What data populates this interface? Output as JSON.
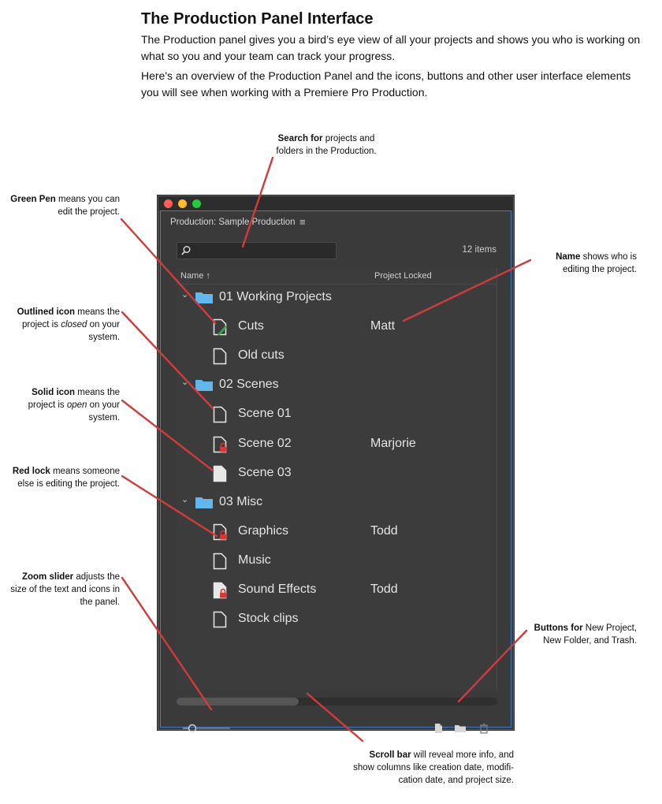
{
  "header": {
    "title": "The Production Panel Interface",
    "paragraph1": "The Production panel gives you a bird’s eye view of all your projects and shows you who is working on what so you and your team can track your progress.",
    "paragraph2": "Here's an overview of the Production Panel and the icons, buttons and other user interface elements you will see when working with a Premiere Pro Production."
  },
  "callouts": {
    "search": {
      "bold": "Search for",
      "rest1": " projects and",
      "line2": "folders in the Production."
    },
    "green_pen": {
      "bold": "Green Pen",
      "rest1": " means you can",
      "line2": "edit the project."
    },
    "outlined": {
      "bold": "Outlined icon",
      "rest1": " means the",
      "line2a": "project is ",
      "line2i": "closed",
      "line2b": " on your",
      "line3": "system."
    },
    "solid": {
      "bold": "Solid icon",
      "rest1": " means the",
      "line2a": "project is ",
      "line2i": "open",
      "line2b": " on your",
      "line3": "system."
    },
    "red_lock": {
      "bold": "Red lock",
      "rest1": " means someone",
      "line2": "else is editing the project."
    },
    "zoom": {
      "bold": "Zoom slider",
      "rest1": " adjusts the",
      "line2": "size of the text and icons in",
      "line3": "the panel."
    },
    "name": {
      "bold": "Name",
      "rest1": " shows who is",
      "line2": "editing the project."
    },
    "buttons": {
      "bold": "Buttons for",
      "rest1": " New Project,",
      "line2": "New Folder, and Trash."
    },
    "scroll": {
      "bold": "Scroll bar",
      "rest1": " will reveal more info, and",
      "line2": "show columns like creation date, modifi-",
      "line3": "cation date, and project size."
    }
  },
  "panel": {
    "title": "Production: Sample Production",
    "menu_glyph": "≡",
    "search_placeholder": "",
    "item_count": "12 items",
    "columns": {
      "name": "Name ↑",
      "locked": "Project Locked"
    },
    "chevron": "⌄",
    "folders": [
      {
        "label": "01 Working Projects",
        "items": [
          {
            "label": "Cuts",
            "state": "green-pen",
            "locked_by": "Matt"
          },
          {
            "label": "Old cuts",
            "state": "outlined",
            "locked_by": ""
          }
        ]
      },
      {
        "label": "02 Scenes",
        "items": [
          {
            "label": "Scene 01",
            "state": "outlined",
            "locked_by": ""
          },
          {
            "label": "Scene 02",
            "state": "outlined-lock",
            "locked_by": "Marjorie"
          },
          {
            "label": "Scene 03",
            "state": "solid",
            "locked_by": ""
          }
        ]
      },
      {
        "label": "03 Misc",
        "items": [
          {
            "label": "Graphics",
            "state": "outlined-lock",
            "locked_by": "Todd"
          },
          {
            "label": "Music",
            "state": "outlined",
            "locked_by": ""
          },
          {
            "label": "Sound Effects",
            "state": "solid-lock",
            "locked_by": "Todd"
          },
          {
            "label": "Stock clips",
            "state": "outlined",
            "locked_by": ""
          }
        ]
      }
    ]
  },
  "colors": {
    "leader_line": "#d23b3b",
    "folder_blue": "#62b8ec",
    "pen_green": "#2fa84f",
    "lock_red": "#e0322f",
    "panel_bg": "#3a3a3a",
    "focus_border": "#3e7ac6"
  }
}
